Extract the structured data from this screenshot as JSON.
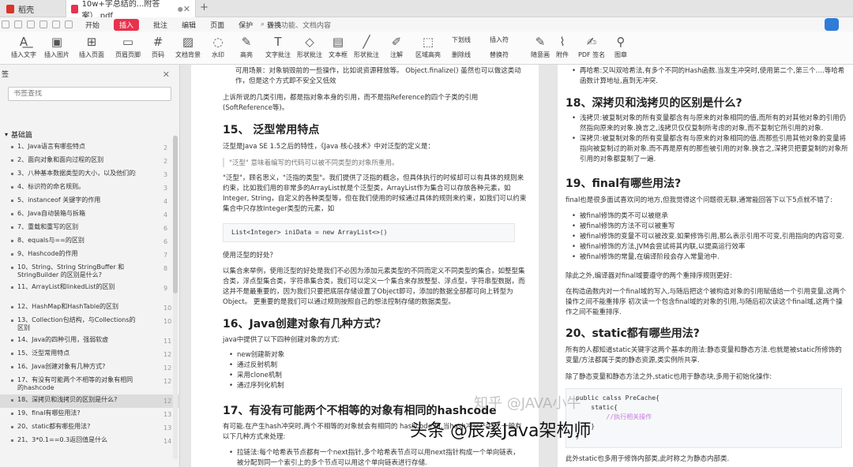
{
  "tabs": [
    {
      "label": "稻壳",
      "active": false
    },
    {
      "label": "10w+字总结的...附答案）.pdf",
      "active": true
    }
  ],
  "menu": {
    "items": [
      "开始",
      "插入",
      "批注",
      "编辑",
      "页面",
      "保护",
      "转换"
    ],
    "active": "插入",
    "search_placeholder": "查找功能、文档内容"
  },
  "toolbar": [
    {
      "label": "插入文字",
      "icon": "text-insert-icon"
    },
    {
      "label": "插入图片",
      "icon": "image-icon"
    },
    {
      "label": "插入页面",
      "icon": "page-insert-icon"
    },
    {
      "label": "页眉页脚",
      "icon": "header-footer-icon"
    },
    {
      "label": "页码",
      "icon": "page-number-icon"
    },
    {
      "label": "文档背景",
      "icon": "background-icon"
    },
    {
      "label": "水印",
      "icon": "watermark-icon"
    },
    {
      "label": "高亮",
      "icon": "highlight-icon"
    },
    {
      "label": "文字批注",
      "icon": "text-comment-icon"
    },
    {
      "label": "形状批注",
      "icon": "shape-comment-icon"
    },
    {
      "label": "文本框",
      "icon": "textbox-icon"
    },
    {
      "label": "形状批注",
      "icon": "shape-icon"
    },
    {
      "label": "注解",
      "icon": "annotation-icon"
    },
    {
      "label": "区域高亮",
      "icon": "area-highlight-icon"
    },
    {
      "label": "下划线",
      "icon": "underline-icon"
    },
    {
      "label": "删除线",
      "icon": "strikethrough-icon"
    },
    {
      "label": "插入符",
      "icon": "caret-icon"
    },
    {
      "label": "替换符",
      "icon": "replace-icon"
    },
    {
      "label": "随意画",
      "icon": "freehand-icon"
    },
    {
      "label": "附件",
      "icon": "attachment-icon"
    },
    {
      "label": "PDF 签名",
      "icon": "signature-icon"
    },
    {
      "label": "图章",
      "icon": "stamp-icon"
    }
  ],
  "sidebar": {
    "title": "签",
    "search_placeholder": "书签查找",
    "root": "基础篇",
    "items": [
      {
        "label": "1、Java语言有哪些特点",
        "page": "2"
      },
      {
        "label": "2、面向对象和面向过程的区别",
        "page": "2"
      },
      {
        "label": "3、八种基本数据类型的大小，以及他们的封装类",
        "page": "3"
      },
      {
        "label": "4、标识符的命名规则。",
        "page": "3"
      },
      {
        "label": "5、instanceof 关键字的作用",
        "page": "4"
      },
      {
        "label": "6、Java自动装箱与拆箱",
        "page": "4"
      },
      {
        "label": "7、重载和重写的区别",
        "page": "6"
      },
      {
        "label": "8、equals与==的区别",
        "page": "6"
      },
      {
        "label": "9、Hashcode的作用",
        "page": "7"
      },
      {
        "label": "10、String、String StringBuffer 和 StringBuilder 的区别是什么?",
        "page": "8"
      },
      {
        "label": "11、ArrayList和linkedList的区别",
        "page": "9"
      },
      {
        "label": "12、HashMap和HashTable的区别",
        "page": "10"
      },
      {
        "label": "13、Collection包结构，与Collections的区别",
        "page": "10"
      },
      {
        "label": "14、Java的四种引用，强弱软虚",
        "page": "11"
      },
      {
        "label": "15、泛型常用特点",
        "page": "12"
      },
      {
        "label": "16、Java创建对象有几种方式?",
        "page": "12"
      },
      {
        "label": "17、有没有可能两个不相等的对象有相同的hashcode",
        "page": "12"
      },
      {
        "label": "18、深拷贝和浅拷贝的区别是什么?",
        "page": "12"
      },
      {
        "label": "19、final有哪些用法?",
        "page": "13"
      },
      {
        "label": "20、static都有哪些用法?",
        "page": "13"
      },
      {
        "label": "21、3*0.1==0.3返回值是什么",
        "page": "14"
      }
    ]
  },
  "page1": {
    "intro1": "可用场景：对象销毁前的一些操作，比如说资源释放等。 Object.finalize() 虽然也可以做这类动作，但是这个方式即不安全又低效",
    "intro2": "上诉所说的几类引用，都是指对象本身的引用，而不是指Reference的四个子类的引用(SoftReference等)。",
    "h15": "15、 泛型常用特点",
    "p15a": "泛型是Java SE 1.5之后的特性，《Java 核心技术》中对泛型的定义是：",
    "quote": "\"泛型\" 意味着编写的代码可以被不同类型的对象所重用。",
    "p15b": "\"泛型\"，顾名思义，\"泛指的类型\"。我们提供了泛指的概念，但具体执行的时候却可以有具体的规则来约束，比如我们用的非常多的ArrayList就是个泛型类，ArrayList作为集合可以存放各种元素，如Integer, String，自定义的各种类型等，但在我们使用的时候通过具体的规则来约束，如我们可以约束集合中只存放Integer类型的元素，如",
    "code": "List<Integer> iniData = new ArrayList<>()",
    "p15c": "使用泛型的好处？",
    "p15d": "以集合来举例，使用泛型的好处是我们不必因为添加元素类型的不同而定义不同类型的集合，如整型集合类，浮点型集合类，字符串集合类，我们可以定义一个集合来存放整型、浮点型，字符串型数据，而这并不是最重要的，因为我们只要把底层存储设置了Object即可，添加的数据全部都可向上转型为Object。 更重要的是我们可以通过规则按照自己的想法控制存储的数据类型。",
    "h16": "16、Java创建对象有几种方式？",
    "p16": "java中提供了以下四种创建对象的方式:",
    "list16": [
      "new创建新对象",
      "通过反射机制",
      "采用clone机制",
      "通过序列化机制"
    ],
    "h17": "17、有没有可能两个不相等的对象有相同的hashcode",
    "p17": "有可能.在产生hash冲突时,两个不相等的对象就会有相同的 hashcode 值.当hash冲突产生时,一般有以下几种方式来处理:",
    "p17b": "拉链法:每个哈希表节点都有一个next指针,多个哈希表节点可以用next指针构成一个单向链表，被分配到同一个索引上的多个节点可以用这个单向链表进行存储."
  },
  "page2": {
    "top": "再哈希:又叫双哈希法,有多个不同的Hash函数.当发生冲突时,使用第二个,第三个….等哈希函数计算地址,直到无冲突.",
    "h18": "18、深拷贝和浅拷贝的区别是什么?",
    "list18": [
      "浅拷贝:被复制对象的所有变量都含有与原来的对象相同的值,而所有的对其他对象的引用仍然指向原来的对象.换言之,浅拷贝仅仅复制所考虑的对象,而不复制它所引用的对象.",
      "深拷贝:被复制对象的所有变量都含有与原来的对象相同的值.而那些引用其他对象的变量将指向被复制过的新对象.而不再是原有的那些被引用的对象.换言之,深拷贝把要复制的对象所引用的对象都复制了一遍."
    ],
    "h19": "19、final有哪些用法?",
    "p19": "final也是很多面试喜欢问的地方,但我觉得这个问题很无聊,通常能回答下以下5点就不错了:",
    "list19": [
      "被final修饰的类不可以被继承",
      "被final修饰的方法不可以被重写",
      "被final修饰的变量不可以被改变.如果修饰引用,那么表示引用不可变,引用指向的内容可变.",
      "被final修饰的方法,JVM会尝试将其内联,以提高运行效率",
      "被final修饰的常量,在编译阶段会存入常量池中."
    ],
    "p19b": "除此之外,编译器对final域要遵守的两个重排序规则更好:",
    "p19c": "在构造函数内对一个final域的写入,与随后把这个被构造对象的引用赋值给一个引用变量,这两个操作之间不能重排序 初次读一个包含final域的对象的引用,与随后初次读这个final域,这两个操作之间不能重排序.",
    "h20": "20、static都有哪些用法?",
    "p20": "所有的人都知道static关键字这两个基本的用法:静态变量和静态方法.也就是被static所修饰的变量/方法都属于类的静态资源,类实例所共享.",
    "p20b": "除了静态变量和静态方法之外,static也用于静态块,多用于初始化操作:",
    "code_lines": [
      "public calss PreCache{",
      "    static{",
      "        //执行相关操作",
      "    }",
      "}"
    ],
    "p20c": "此外static也多用于修饰内部类,此时称之为静态内部类."
  },
  "watermark": {
    "main": "头条 @辰溪Java架构师",
    "faint": "知乎 @JAVA小牛"
  },
  "colors": {
    "accent": "#e8324d",
    "cloud": "#2f7bd8"
  }
}
